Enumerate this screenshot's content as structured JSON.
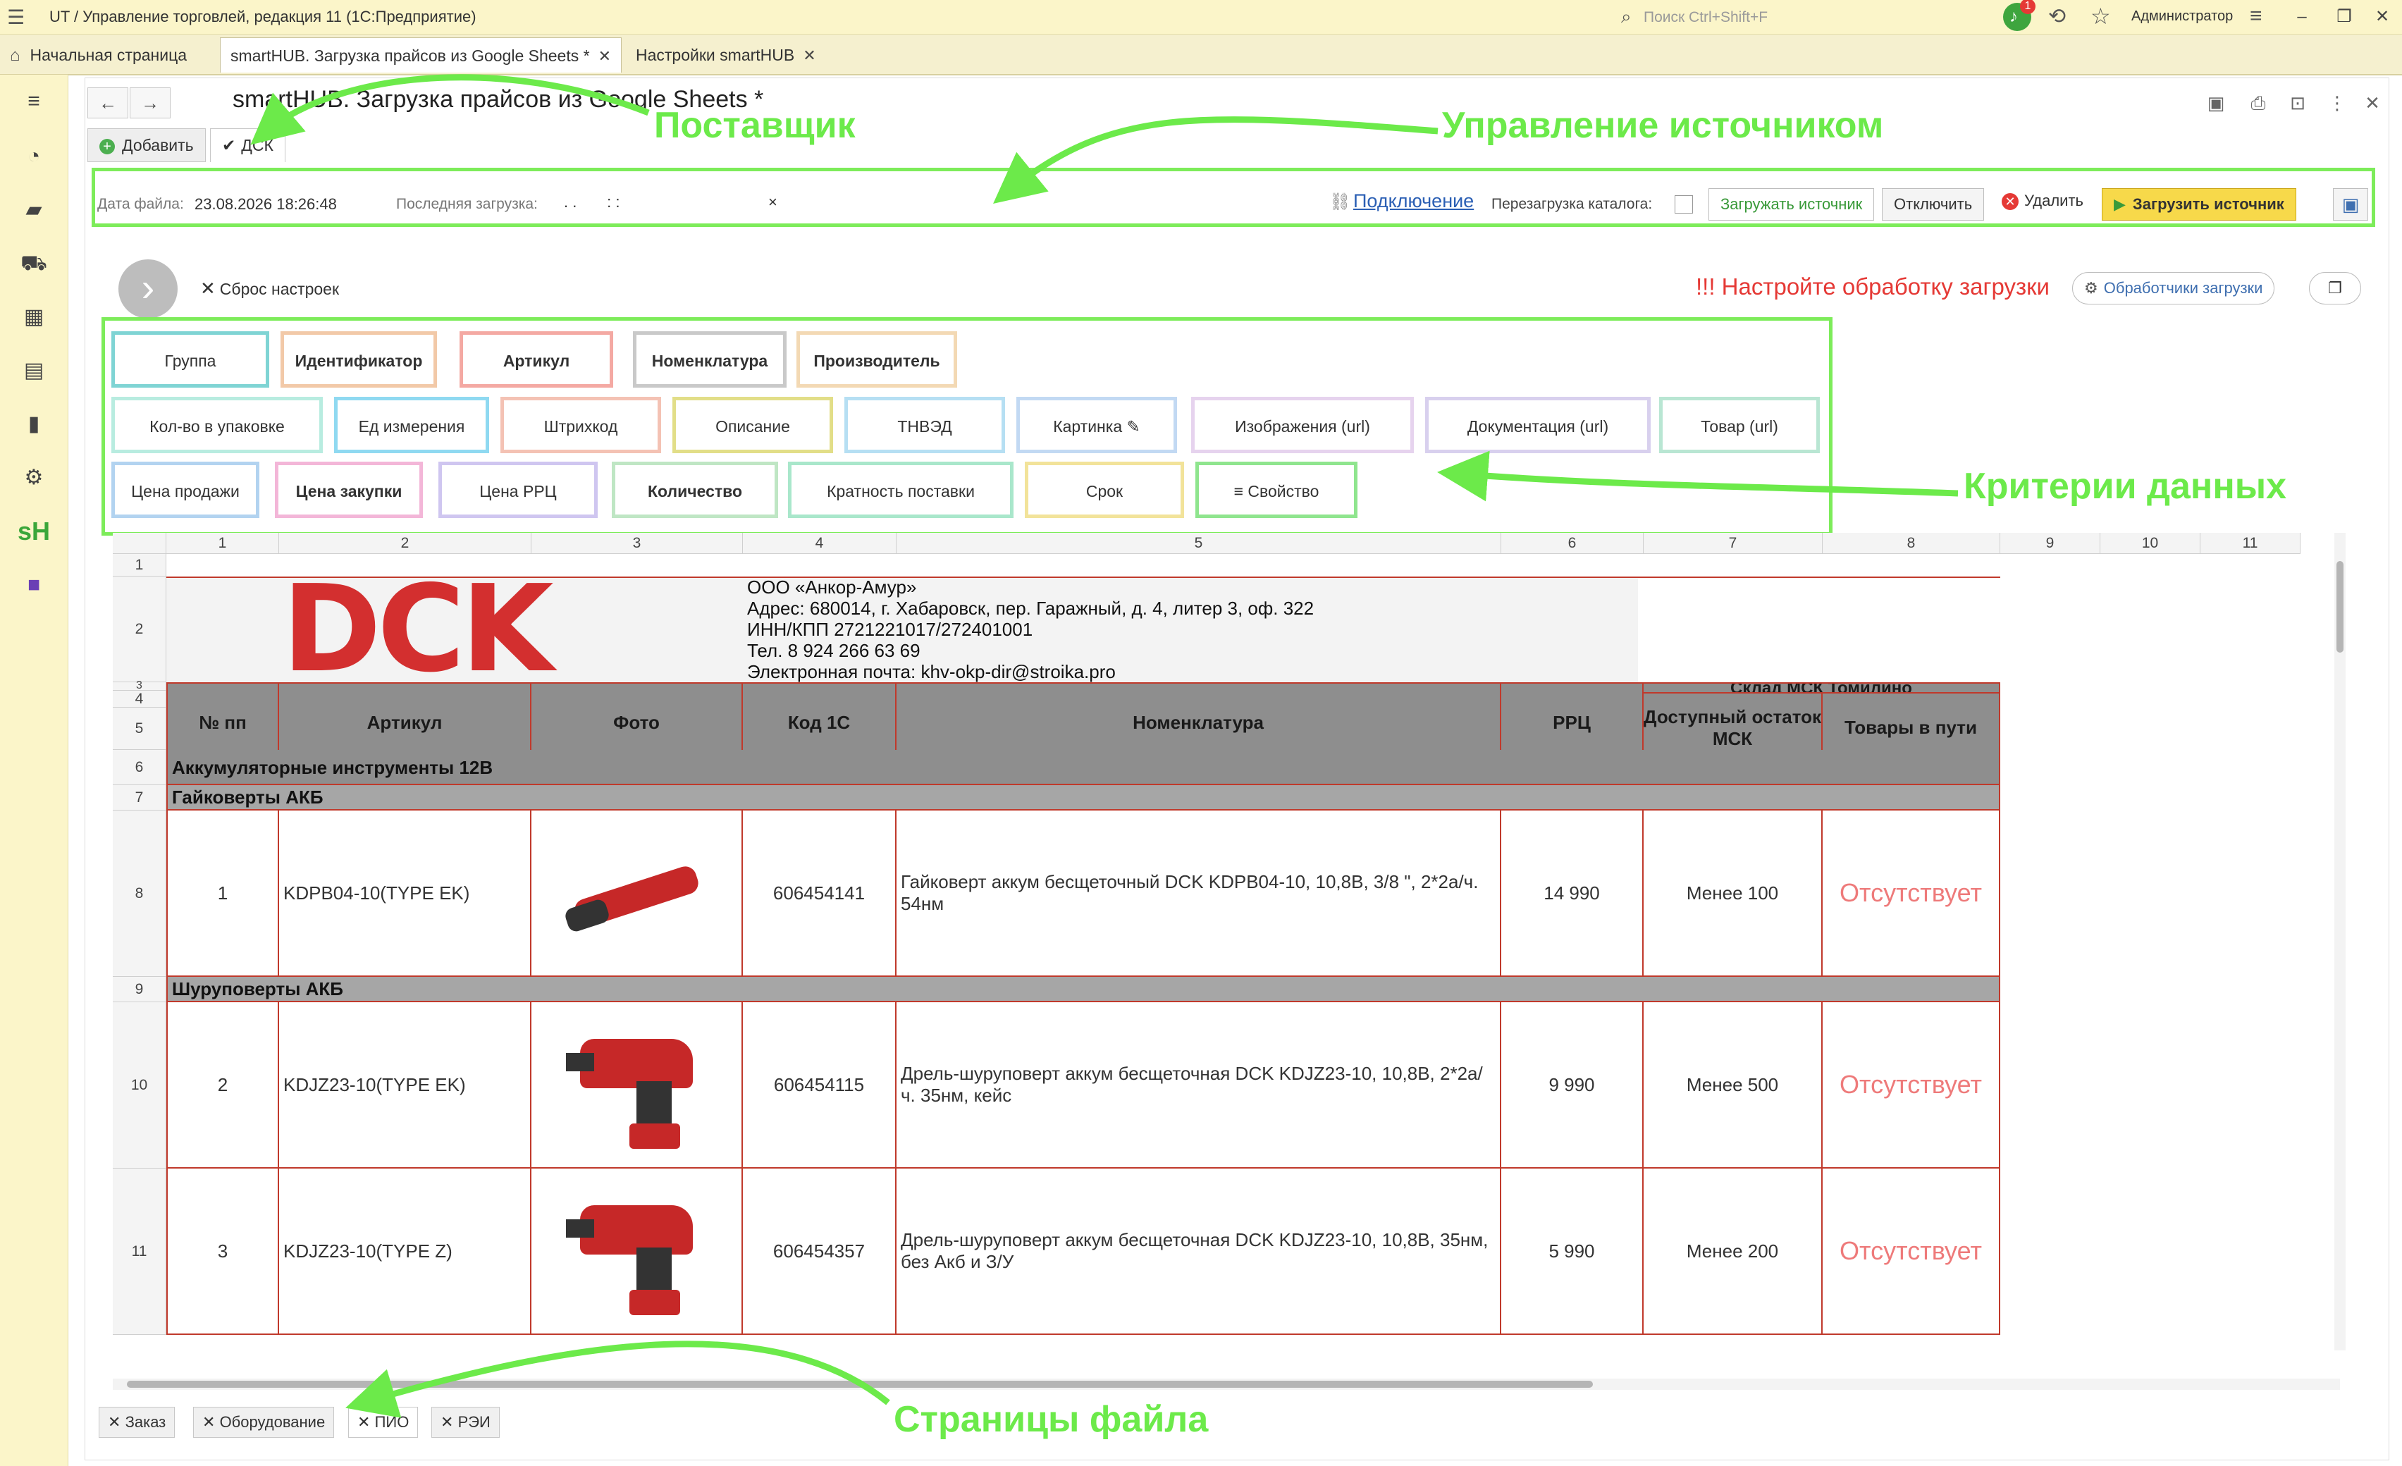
{
  "window": {
    "title": "UT / Управление торговлей, редакция 11  (1С:Предприятие)",
    "search_placeholder": "Поиск Ctrl+Shift+F",
    "notification_count": "1",
    "user": "Администратор"
  },
  "tabs": [
    {
      "label": "Начальная страница"
    },
    {
      "label": "smartHUB. Загрузка прайсов из Google Sheets *"
    },
    {
      "label": "Настройки smartHUB"
    }
  ],
  "form": {
    "title": "smartHUB. Загрузка прайсов из Google Sheets *",
    "add_button": "Добавить",
    "supplier_tab": "ДСК"
  },
  "source": {
    "file_date_label": "Дата файла:",
    "file_date_value": "23.08.2026 18:26:48",
    "last_load_label": "Последняя загрузка:",
    "last_load_value": ". .       : :",
    "clear": "×",
    "connection_link": "Подключение",
    "reload_catalog_label": "Перезагрузка каталога:",
    "load_source_toggle": "Загружать источник",
    "disable_toggle": "Отключить",
    "delete_button": "Удалить",
    "load_button": "Загрузить источник"
  },
  "settings": {
    "reset": "Сброс настроек",
    "warning": "!!! Настройте обработку загрузки",
    "handlers_button": "Обработчики загрузки"
  },
  "criteria": {
    "row1": [
      {
        "label": "Группа",
        "bold": false,
        "color": "#7fd4d4"
      },
      {
        "label": "Идентификатор",
        "bold": true,
        "color": "#f2c9a8"
      },
      {
        "label": "Артикул",
        "bold": true,
        "color": "#f4a9a3"
      },
      {
        "label": "Номенклатура",
        "bold": true,
        "color": "#c9c9c9"
      },
      {
        "label": "Производитель",
        "bold": true,
        "color": "#f3d9b4"
      }
    ],
    "row2": [
      {
        "label": "Кол-во в упаковке",
        "bold": false,
        "color": "#b8ece0"
      },
      {
        "label": "Ед измерения",
        "bold": false,
        "color": "#8fd9f1"
      },
      {
        "label": "Штрихкод",
        "bold": false,
        "color": "#f4c2b4"
      },
      {
        "label": "Описание",
        "bold": false,
        "color": "#e2de88"
      },
      {
        "label": "ТНВЭД",
        "bold": false,
        "color": "#b6dff3"
      },
      {
        "label": "Картинка ✎",
        "bold": false,
        "color": "#c2d9f3"
      },
      {
        "label": "Изображения (url)",
        "bold": false,
        "color": "#e6d3ee"
      },
      {
        "label": "Документация (url)",
        "bold": false,
        "color": "#d8d0ee"
      },
      {
        "label": "Товар (url)",
        "bold": false,
        "color": "#b9e6d3"
      }
    ],
    "row3": [
      {
        "label": "Цена продажи",
        "bold": false,
        "color": "#b2d3f0"
      },
      {
        "label": "Цена закупки",
        "bold": true,
        "color": "#f3b6d8"
      },
      {
        "label": "Цена РРЦ",
        "bold": false,
        "color": "#cfc6f0"
      },
      {
        "label": "Количество",
        "bold": true,
        "color": "#bfe6c4"
      },
      {
        "label": "Кратность поставки",
        "bold": false,
        "color": "#a9e7cb"
      },
      {
        "label": "Срок",
        "bold": false,
        "color": "#f2e39a"
      },
      {
        "label": "≡ Свойство",
        "bold": false,
        "color": "#8fe58e"
      }
    ]
  },
  "sheet": {
    "columns": [
      "1",
      "2",
      "3",
      "4",
      "5",
      "6",
      "7",
      "8",
      "9",
      "10",
      "11"
    ],
    "rows": [
      "1",
      "2",
      "3",
      "4",
      "5",
      "6",
      "7",
      "8",
      "9",
      "10",
      "11"
    ],
    "logo_text": "DCK",
    "company_lines": [
      "ООО «Анкор-Амур»",
      "Адрес: 680014, г. Хабаровск, пер. Гаражный, д. 4, литер 3, оф. 322",
      "ИНН/КПП 2721221017/272401001",
      "Тел. 8 924 266 63 69",
      "Электронная почта: khv-okp-dir@stroika.pro"
    ],
    "headers": {
      "num": "№ пп",
      "article": "Артикул",
      "photo": "Фото",
      "code1c": "Код 1С",
      "nomenclature": "Номенклатура",
      "rrp": "РРЦ",
      "warehouse": "Склад МСК Томилино",
      "stock": "Доступный остаток МСК",
      "transit": "Товары в пути"
    },
    "group_main": "Аккумуляторные инструменты 12В",
    "subgroups": [
      "Гайковерты АКБ",
      "Шуруповерты АКБ"
    ],
    "items": [
      {
        "num": "1",
        "article": "KDPB04-10(TYPE EK)",
        "code": "606454141",
        "name": "Гайковерт аккум  бесщеточный DCK KDPB04-10, 10,8В, 3/8 \", 2*2а/ч. 54нм",
        "rrp": "14 990",
        "stock": "Менее 100",
        "transit": "Отсутствует"
      },
      {
        "num": "2",
        "article": "KDJZ23-10(TYPE EK)",
        "code": "606454115",
        "name": "Дрель-шуруповерт аккум бесщеточная DCK KDJZ23-10, 10,8В, 2*2а/ч. 35нм, кейс",
        "rrp": "9 990",
        "stock": "Менее 500",
        "transit": "Отсутствует"
      },
      {
        "num": "3",
        "article": "KDJZ23-10(TYPE Z)",
        "code": "606454357",
        "name": "Дрель-шуруповерт аккум бесщеточная DCK KDJZ23-10, 10,8В, 35нм, без Акб и З/У",
        "rrp": "5 990",
        "stock": "Менее 200",
        "transit": "Отсутствует"
      }
    ]
  },
  "sheet_tabs": [
    "Заказ",
    "Оборудование",
    "ПИО",
    "РЭИ"
  ],
  "annotations": {
    "supplier": "Поставщик",
    "source_control": "Управление источником",
    "criteria": "Критерии данных",
    "pages": "Страницы файла"
  },
  "colors": {
    "annotation": "#6cea4a",
    "titlebar": "#fbf5c9",
    "accent_button": "#f7d94a",
    "grid_border": "#c0392b",
    "missing_text": "#ee7a7a",
    "logo": "#d32f2f"
  }
}
